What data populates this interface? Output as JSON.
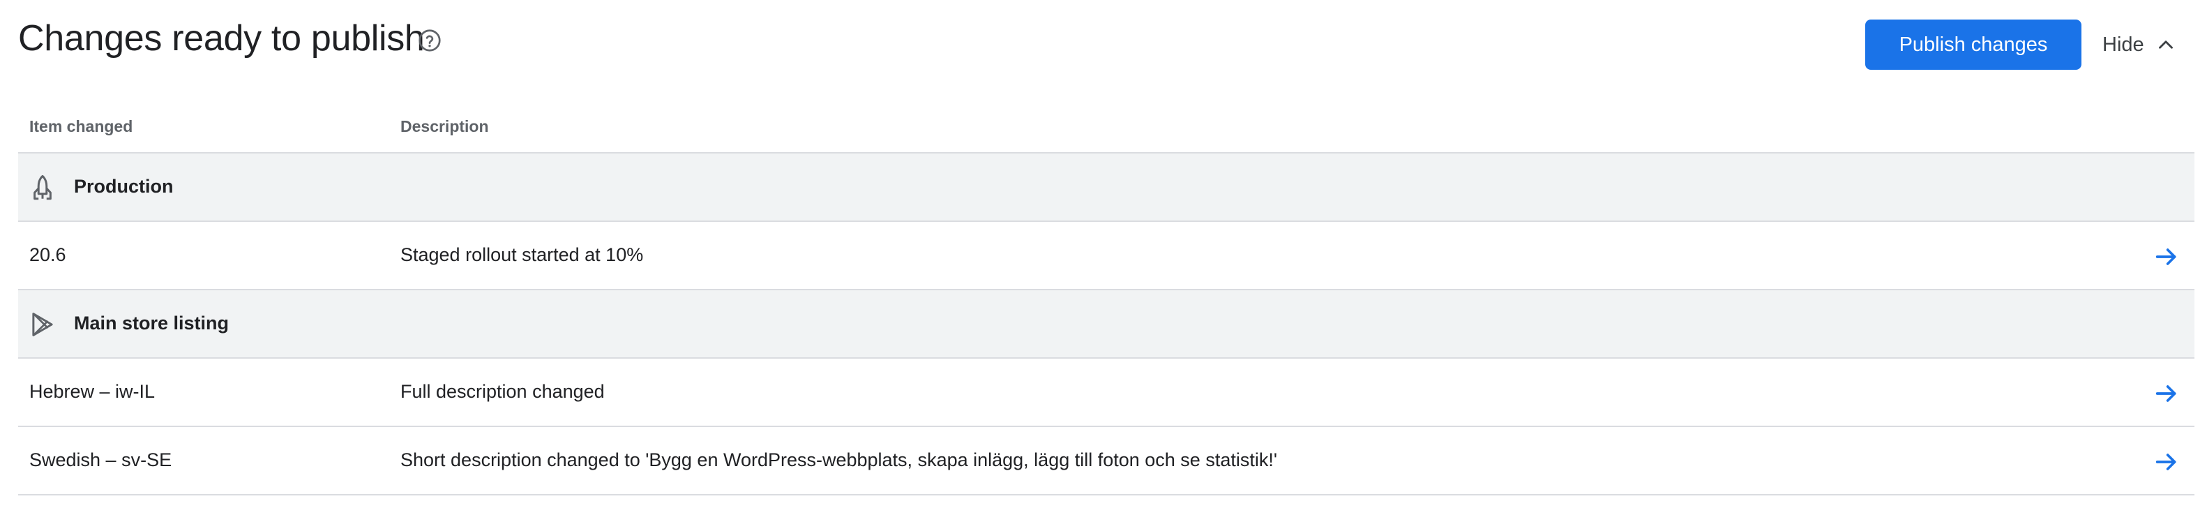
{
  "header": {
    "title": "Changes ready to publish",
    "publish_label": "Publish changes",
    "hide_label": "Hide"
  },
  "table": {
    "columns": [
      "Item changed",
      "Description"
    ],
    "groups": [
      {
        "label": "Production",
        "icon": "rocket-icon",
        "rows": [
          {
            "item": "20.6",
            "description": "Staged rollout started at 10%"
          }
        ]
      },
      {
        "label": "Main store listing",
        "icon": "play-store-icon",
        "rows": [
          {
            "item": "Hebrew – iw-IL",
            "description": "Full description changed"
          },
          {
            "item": "Swedish – sv-SE",
            "description": "Short description changed to 'Bygg en WordPress-webbplats, skapa inlägg, lägg till foton och se statistik!'"
          }
        ]
      }
    ]
  },
  "colors": {
    "accent": "#1a73e8",
    "group_bg": "#f1f3f4",
    "divider": "#dadce0",
    "text": "#202124",
    "muted": "#5f6368"
  }
}
